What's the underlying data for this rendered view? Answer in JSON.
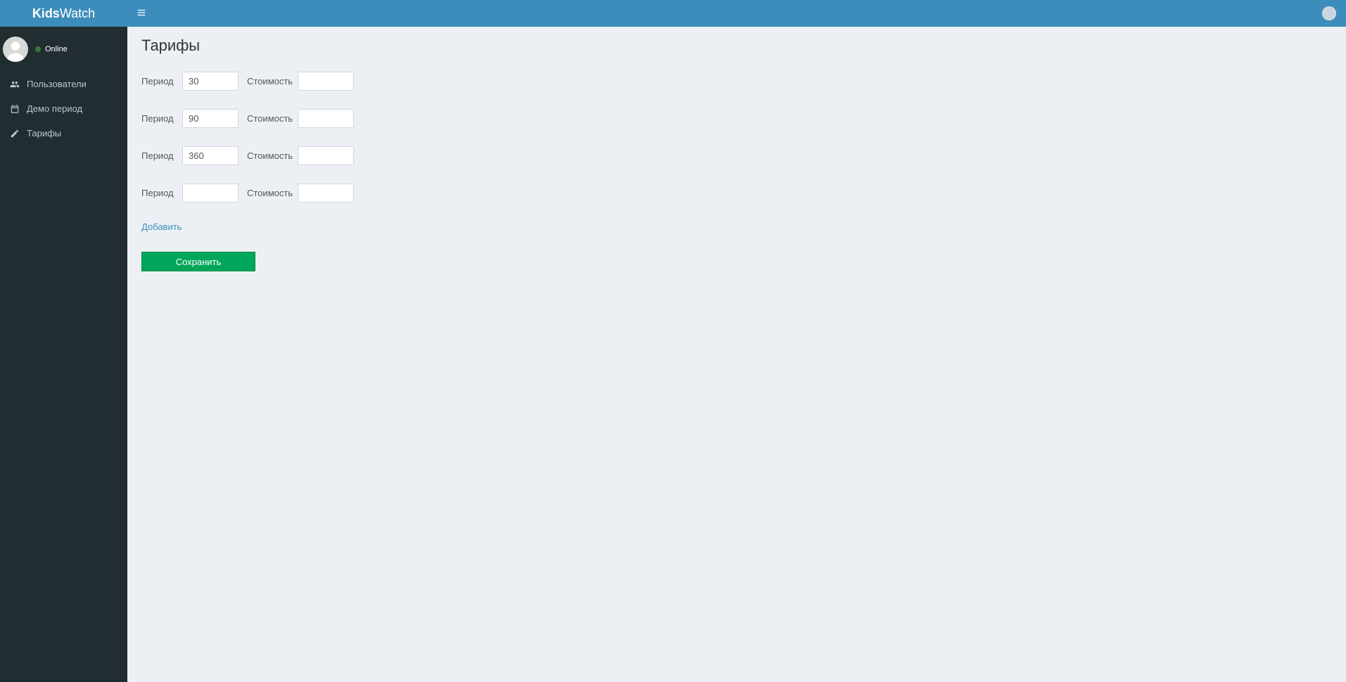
{
  "brand": {
    "bold": "Kids",
    "rest": "Watch"
  },
  "user": {
    "status_label": "Online"
  },
  "sidebar": {
    "items": [
      {
        "label": "Пользователи"
      },
      {
        "label": "Демо период"
      },
      {
        "label": "Тарифы"
      }
    ]
  },
  "page": {
    "title": "Тарифы",
    "period_label": "Период",
    "cost_label": "Стоимость",
    "rows": [
      {
        "period": "30",
        "cost": ""
      },
      {
        "period": "90",
        "cost": ""
      },
      {
        "period": "360",
        "cost": ""
      },
      {
        "period": "",
        "cost": ""
      }
    ],
    "add_label": "Добавить",
    "save_label": "Сохранить"
  }
}
